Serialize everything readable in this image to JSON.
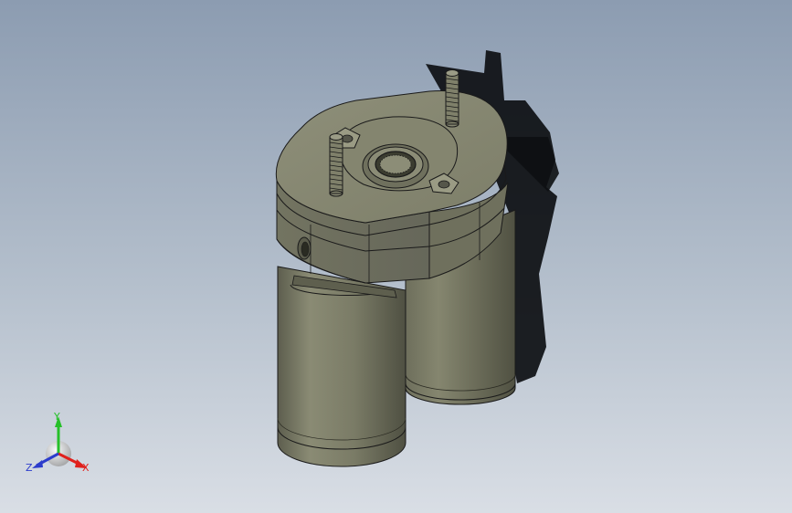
{
  "viewport": {
    "background_top": "#8c9cb1",
    "background_bottom": "#d9dee5"
  },
  "model": {
    "body_color": "#7b7c68",
    "edge_color": "#1a1a1a",
    "shadow_color": "#0d0f12"
  },
  "triad": {
    "labels": {
      "x": "X",
      "y": "Y",
      "z": "Z"
    },
    "colors": {
      "x": "#e0201c",
      "y": "#26c029",
      "z": "#2c3ccc"
    }
  }
}
